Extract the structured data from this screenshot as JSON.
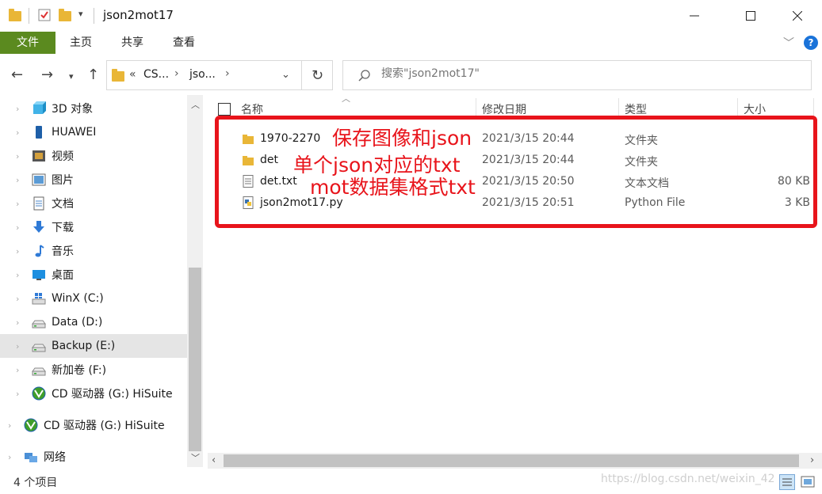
{
  "window": {
    "title": "json2mot17"
  },
  "ribbon": {
    "tabs": [
      "文件",
      "主页",
      "共享",
      "查看"
    ],
    "help": "?"
  },
  "address": {
    "prefix": "«",
    "parts": [
      "CS...",
      "jso..."
    ]
  },
  "search": {
    "placeholder": "搜索\"json2mot17\""
  },
  "nav": {
    "items": [
      {
        "label": "3D 对象",
        "icon": "3d-objects-icon"
      },
      {
        "label": "HUAWEI",
        "icon": "phone-icon"
      },
      {
        "label": "视频",
        "icon": "video-icon"
      },
      {
        "label": "图片",
        "icon": "pictures-icon"
      },
      {
        "label": "文档",
        "icon": "documents-icon"
      },
      {
        "label": "下载",
        "icon": "download-icon"
      },
      {
        "label": "音乐",
        "icon": "music-icon"
      },
      {
        "label": "桌面",
        "icon": "desktop-icon"
      },
      {
        "label": "WinX (C:)",
        "icon": "windows-drive-icon"
      },
      {
        "label": "Data (D:)",
        "icon": "drive-icon"
      },
      {
        "label": "Backup (E:)",
        "icon": "drive-icon"
      },
      {
        "label": "新加卷 (F:)",
        "icon": "drive-icon"
      },
      {
        "label": "CD 驱动器 (G:) HiSuite",
        "icon": "cd-drive-icon"
      },
      {
        "label": "CD 驱动器 (G:) HiSuite",
        "icon": "cd-drive-icon"
      },
      {
        "label": "网络",
        "icon": "network-icon"
      }
    ]
  },
  "columns": {
    "name": "名称",
    "date": "修改日期",
    "type": "类型",
    "size": "大小"
  },
  "files": [
    {
      "name": "1970-2270",
      "date": "2021/3/15 20:44",
      "type": "文件夹",
      "size": "",
      "icon": "folder-icon"
    },
    {
      "name": "det",
      "date": "2021/3/15 20:44",
      "type": "文件夹",
      "size": "",
      "icon": "folder-icon"
    },
    {
      "name": "det.txt",
      "date": "2021/3/15 20:50",
      "type": "文本文档",
      "size": "80 KB",
      "icon": "text-file-icon"
    },
    {
      "name": "json2mot17.py",
      "date": "2021/3/15 20:51",
      "type": "Python File",
      "size": "3 KB",
      "icon": "python-file-icon"
    }
  ],
  "annotations": [
    "保存图像和json",
    "单个json对应的txt",
    "mot数据集格式txt"
  ],
  "status": {
    "count": "4 个项目"
  },
  "watermark": "https://blog.csdn.net/weixin_42"
}
